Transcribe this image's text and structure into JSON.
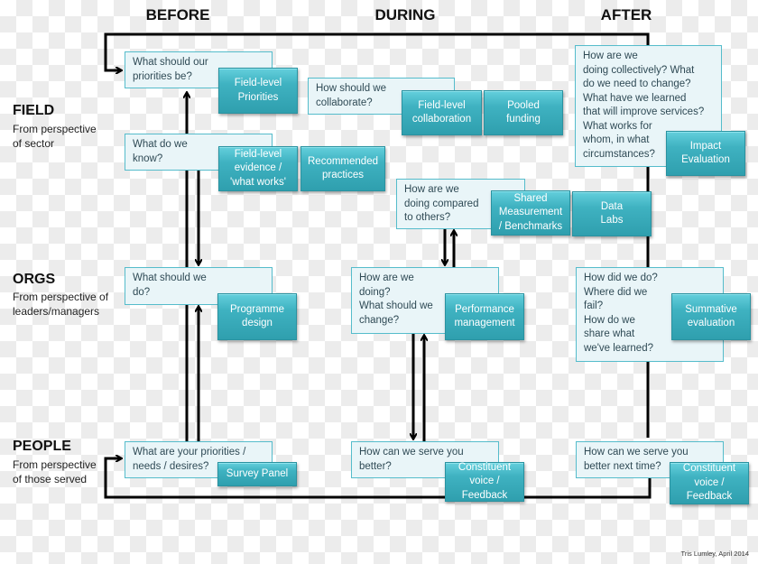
{
  "headers": {
    "before": "BEFORE",
    "during": "DURING",
    "after": "AFTER"
  },
  "rows": {
    "field": {
      "title": "FIELD",
      "sub": "From perspective\nof sector"
    },
    "orgs": {
      "title": "ORGS",
      "sub": "From perspective of\nleaders/managers"
    },
    "people": {
      "title": "PEOPLE",
      "sub": "From perspective\nof those served"
    }
  },
  "questions": {
    "field_before_1": "What should our\npriorities be?",
    "field_during_1": "How should we\ncollaborate?",
    "field_before_2": "What do we\nknow?",
    "field_after": "How are we\ndoing collectively? What\ndo we need to change?\nWhat have we learned\nthat will improve services?\nWhat works for\nwhom, in what\ncircumstances?",
    "field_during_2": "How are we\ndoing compared\nto others?",
    "orgs_before": "What should we\ndo?",
    "orgs_during": "How are we\ndoing?\nWhat should we\nchange?",
    "orgs_after": "How did we do?\nWhere did we\nfail?\nHow do we\nshare what\nwe've learned?",
    "people_before": "What are your priorities /\nneeds / desires?",
    "people_during": "How can we serve you\nbetter?",
    "people_after": "How can we serve you\nbetter next time?"
  },
  "tools": {
    "field_level_priorities": "Field-level\nPriorities",
    "field_level_collaboration": "Field-level\ncollaboration",
    "pooled_funding": "Pooled\nfunding",
    "field_level_evidence": "Field-level\nevidence /\n'what works'",
    "recommended_practices": "Recommended\npractices",
    "impact_evaluation": "Impact\nEvaluation",
    "shared_measurement": "Shared\nMeasurement\n/ Benchmarks",
    "data_labs": "Data\nLabs",
    "programme_design": "Programme\ndesign",
    "performance_management": "Performance\nmanagement",
    "summative_evaluation": "Summative\nevaluation",
    "survey_panel": "Survey Panel",
    "constituent_voice_during": "Constituent\nvoice /\nFeedback",
    "constituent_voice_after": "Constituent\nvoice /\nFeedback"
  },
  "credit": "Tris Lumley, April 2014",
  "colors": {
    "tool_box": "#3fb2c1",
    "question_box": "#e9f5f8",
    "question_border": "#55bccb",
    "lines": "#000000"
  }
}
